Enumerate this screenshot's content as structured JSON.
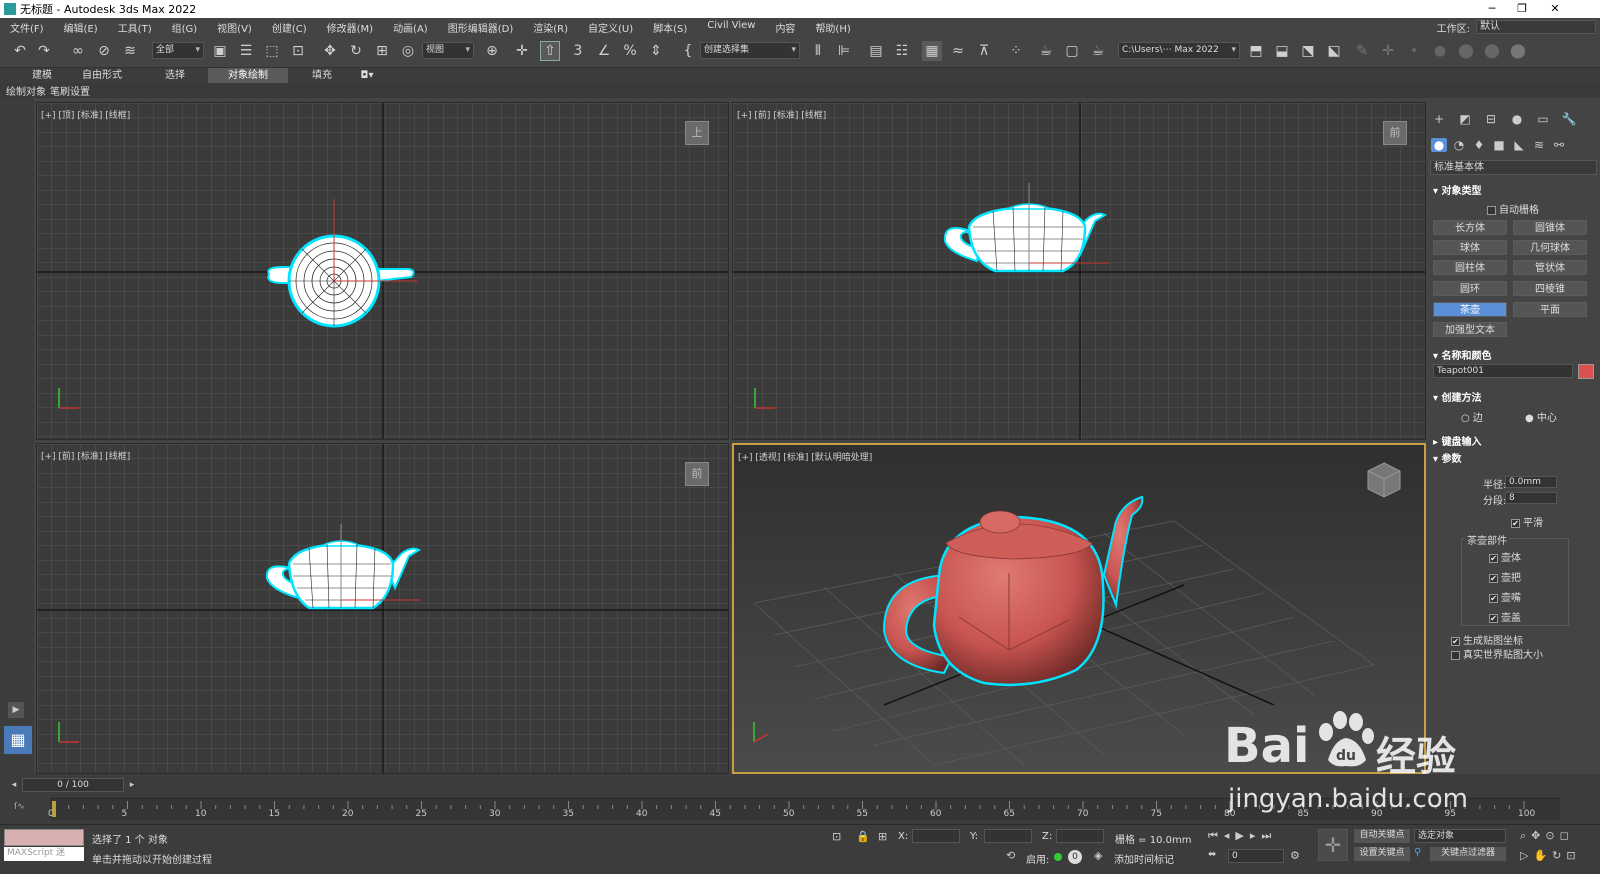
{
  "titlebar": {
    "title": "无标题 - Autodesk 3ds Max 2022",
    "min": "─",
    "max": "❐",
    "close": "✕"
  },
  "menu": {
    "items": [
      "文件(F)",
      "编辑(E)",
      "工具(T)",
      "组(G)",
      "视图(V)",
      "创建(C)",
      "修改器(M)",
      "动画(A)",
      "图形编辑器(D)",
      "渲染(R)",
      "自定义(U)",
      "脚本(S)",
      "Civil View",
      "内容",
      "帮助(H)"
    ],
    "workspace_label": "工作区:",
    "workspace_value": "默认"
  },
  "toolbar": {
    "filter_value": "全部",
    "coord_value": "视图",
    "selection_set_value": "创建选择集",
    "project_path": "C:\\Users\\⋯ Max 2022"
  },
  "ribbon": {
    "tabs": [
      "建模",
      "自由形式",
      "选择",
      "对象绘制",
      "填充"
    ],
    "active_tab": "对象绘制",
    "subtabs": [
      "绘制对象",
      "笔刷设置"
    ]
  },
  "viewports": {
    "top": {
      "label": "[+] [顶] [标准] [线框]",
      "nav": "上"
    },
    "front": {
      "label": "[+] [前] [标准] [线框]",
      "nav": "前"
    },
    "left": {
      "label": "[+] [前] [标准] [线框]",
      "nav": "前"
    },
    "persp": {
      "label": "[+] [透视] [标准] [默认明暗处理]"
    }
  },
  "command_panel": {
    "category": "标准基本体",
    "object_type": {
      "title": "对象类型",
      "autogrid": "自动栅格",
      "buttons": [
        "长方体",
        "圆锥体",
        "球体",
        "几何球体",
        "圆柱体",
        "管状体",
        "圆环",
        "四棱锥",
        "茶壶",
        "平面",
        "加强型文本"
      ],
      "active": "茶壶"
    },
    "name_color": {
      "title": "名称和颜色",
      "name": "Teapot001",
      "color": "#d9524f"
    },
    "creation_method": {
      "title": "创建方法",
      "edge": "边",
      "center": "中心"
    },
    "keyboard_entry": {
      "title": "键盘输入"
    },
    "parameters": {
      "title": "参数",
      "radius_label": "半径:",
      "radius_value": "0.0mm",
      "segments_label": "分段:",
      "segments_value": "8",
      "smooth": "平滑",
      "parts_title": "茶壶部件",
      "parts": [
        "壶体",
        "壶把",
        "壶嘴",
        "壶盖"
      ],
      "gen_map": "生成贴图坐标",
      "real_world": "真实世界贴图大小"
    }
  },
  "timeline": {
    "frame_display": "0 / 100",
    "ticks": [
      "0",
      "5",
      "10",
      "15",
      "20",
      "25",
      "30",
      "35",
      "40",
      "45",
      "50",
      "55",
      "60",
      "65",
      "70",
      "75",
      "80",
      "85",
      "90",
      "95",
      "100"
    ]
  },
  "status": {
    "maxscript": "MAXScript 迷",
    "selected": "选择了 1 个 对象",
    "prompt": "单击并拖动以开始创建过程",
    "x_label": "X:",
    "y_label": "Y:",
    "z_label": "Z:",
    "grid": "栅格 = 10.0mm",
    "enabled": "启用:",
    "add_time_tag": "添加时间标记",
    "auto_key": "自动关键点",
    "set_key": "设置关键点",
    "selected_object": "选定对象",
    "key_filters": "关键点过滤器",
    "frame_value": "0"
  },
  "watermark": {
    "brand": "Bai",
    "brand2": "经验",
    "url": "jingyan.baidu.com"
  },
  "colors": {
    "selection_outline": "#00e5ff",
    "teapot_shaded": "#c85450",
    "active_button": "#5b8fd8"
  }
}
